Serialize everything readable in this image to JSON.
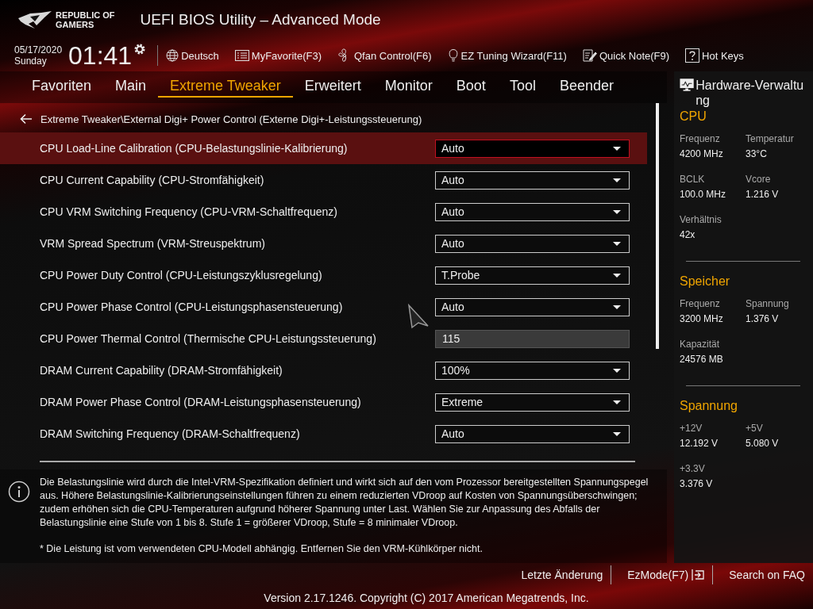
{
  "header": {
    "brand": [
      "REPUBLIC OF",
      "GAMERS"
    ],
    "title": "UEFI BIOS Utility – Advanced Mode"
  },
  "toolbar": {
    "date": "05/17/2020",
    "day": "Sunday",
    "time": "01:41",
    "items": [
      {
        "kind": "language",
        "label": "Deutsch"
      },
      {
        "kind": "favorite",
        "label": "MyFavorite(F3)"
      },
      {
        "kind": "fan",
        "label": "Qfan Control(F6)"
      },
      {
        "kind": "wizard",
        "label": "EZ Tuning Wizard(F11)"
      },
      {
        "kind": "note",
        "label": "Quick Note(F9)"
      },
      {
        "kind": "hotkeys",
        "label": "Hot Keys"
      }
    ]
  },
  "tabs": [
    {
      "label": "Favoriten",
      "selected": false
    },
    {
      "label": "Main",
      "selected": false
    },
    {
      "label": "Extreme Tweaker",
      "selected": true
    },
    {
      "label": "Erweitert",
      "selected": false
    },
    {
      "label": "Monitor",
      "selected": false
    },
    {
      "label": "Boot",
      "selected": false
    },
    {
      "label": "Tool",
      "selected": false
    },
    {
      "label": "Beender",
      "selected": false
    }
  ],
  "breadcrumb": "Extreme Tweaker\\External Digi+ Power Control (Externe Digi+-Leistungssteuerung)",
  "settings": [
    {
      "label": "CPU Load-Line Calibration (CPU-Belastungslinie-Kalibrierung)",
      "kind": "dropdown",
      "value": "Auto",
      "selected": true
    },
    {
      "label": "CPU Current Capability (CPU-Stromfähigkeit)",
      "kind": "dropdown",
      "value": "Auto",
      "selected": false
    },
    {
      "label": "CPU VRM Switching Frequency (CPU-VRM-Schaltfrequenz)",
      "kind": "dropdown",
      "value": "Auto",
      "selected": false
    },
    {
      "label": "VRM Spread Spectrum (VRM-Streuspektrum)",
      "kind": "dropdown",
      "value": "Auto",
      "selected": false
    },
    {
      "label": "CPU Power Duty Control (CPU-Leistungszyklusregelung)",
      "kind": "dropdown",
      "value": "T.Probe",
      "selected": false
    },
    {
      "label": "CPU Power Phase Control (CPU-Leistungsphasensteuerung)",
      "kind": "dropdown",
      "value": "Auto",
      "selected": false
    },
    {
      "label": "CPU Power Thermal Control (Thermische CPU-Leistungssteuerung)",
      "kind": "number",
      "value": "115",
      "selected": false
    },
    {
      "label": "DRAM Current Capability (DRAM-Stromfähigkeit)",
      "kind": "dropdown",
      "value": "100%",
      "selected": false
    },
    {
      "label": "DRAM Power Phase Control (DRAM-Leistungsphasensteuerung)",
      "kind": "dropdown",
      "value": "Extreme",
      "selected": false
    },
    {
      "label": "DRAM Switching Frequency (DRAM-Schaltfrequenz)",
      "kind": "dropdown",
      "value": "Auto",
      "selected": false
    }
  ],
  "help": {
    "text": "Die Belastungslinie wird durch die Intel-VRM-Spezifikation definiert und wirkt sich auf den vom Prozessor bereitgestellten Spannungspegel aus. Höhere Belastungslinie-Kalibrierungseinstellungen führen zu einem reduzierten VDroop auf Kosten von Spannungsüberschwingen; zudem erhöhen sich die CPU-Temperaturen aufgrund höherer Spannung unter Last. Wählen Sie zur Anpassung des Abfalls der Belastungslinie eine Stufe von 1 bis 8. Stufe 1 = größerer VDroop, Stufe = 8 minimaler VDroop.",
    "note": "* Die Leistung ist vom verwendeten CPU-Modell abhängig. Entfernen Sie den VRM-Kühlkörper nicht."
  },
  "hardware": {
    "title": "Hardware-Verwaltung",
    "sections": [
      {
        "title": "CPU",
        "items": [
          {
            "label": "Frequenz",
            "value": "4200 MHz"
          },
          {
            "label": "Temperatur",
            "value": "33°C"
          },
          {
            "label": "BCLK",
            "value": "100.0 MHz"
          },
          {
            "label": "Vcore",
            "value": "1.216 V"
          },
          {
            "label": "Verhältnis",
            "value": "42x"
          }
        ]
      },
      {
        "title": "Speicher",
        "items": [
          {
            "label": "Frequenz",
            "value": "3200 MHz"
          },
          {
            "label": "Spannung",
            "value": "1.376 V"
          },
          {
            "label": "Kapazität",
            "value": "24576 MB"
          }
        ]
      },
      {
        "title": "Spannung",
        "items": [
          {
            "label": "+12V",
            "value": "12.192 V"
          },
          {
            "label": "+5V",
            "value": "5.080 V"
          },
          {
            "label": "+3.3V",
            "value": "3.376 V"
          }
        ]
      }
    ]
  },
  "footer": {
    "links": [
      {
        "label": "Letzte Änderung",
        "kind": "plain"
      },
      {
        "label": "EzMode(F7)",
        "kind": "exit"
      },
      {
        "label": "Search on FAQ",
        "kind": "plain"
      }
    ],
    "version": "Version 2.17.1246. Copyright (C) 2017 American Megatrends, Inc."
  }
}
